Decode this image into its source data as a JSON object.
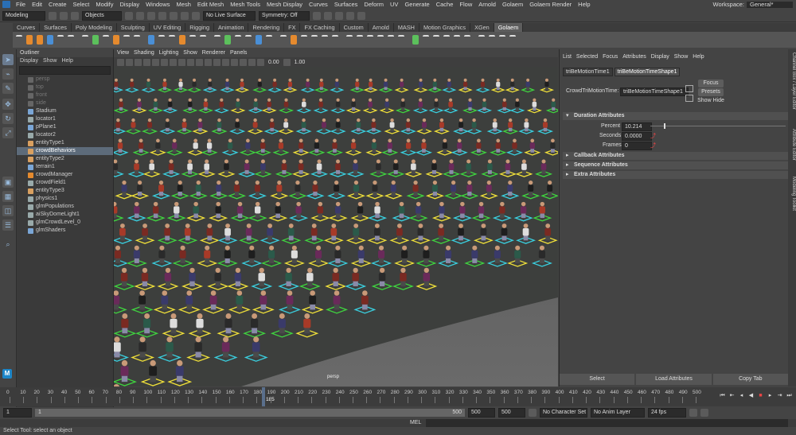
{
  "menubar": {
    "items": [
      "File",
      "Edit",
      "Create",
      "Select",
      "Modify",
      "Display",
      "Windows",
      "Mesh",
      "Edit Mesh",
      "Mesh Tools",
      "Mesh Display",
      "Curves",
      "Surfaces",
      "Deform",
      "UV",
      "Generate",
      "Cache",
      "Flow",
      "Arnold",
      "Golaem",
      "Golaem Render",
      "Help"
    ],
    "workspace_label": "Workspace:",
    "workspace_value": "General*"
  },
  "statusline": {
    "mode": "Modeling",
    "objects_label": "Objects",
    "live_surface": "No Live Surface",
    "symmetry": "Symmetry: Off"
  },
  "shelf": {
    "tabs": [
      "Curves",
      "Surfaces",
      "Poly Modeling",
      "Sculpting",
      "UV Editing",
      "Rigging",
      "Animation",
      "Rendering",
      "FX",
      "FX Caching",
      "Custom",
      "Arnold",
      "MASH",
      "Motion Graphics",
      "XGen",
      "Golaem"
    ],
    "active_tab": "Golaem"
  },
  "outliner": {
    "title": "Outliner",
    "menus": [
      "Display",
      "Show",
      "Help"
    ],
    "items": [
      {
        "label": "persp",
        "state": "dim"
      },
      {
        "label": "top",
        "state": "dim"
      },
      {
        "label": "front",
        "state": "dim"
      },
      {
        "label": "side",
        "state": "dim"
      },
      {
        "label": "Stadium",
        "state": "normal"
      },
      {
        "label": "locator1",
        "state": "normal"
      },
      {
        "label": "pPlane1",
        "state": "normal"
      },
      {
        "label": "locator2",
        "state": "normal"
      },
      {
        "label": "entityType1",
        "state": "normal"
      },
      {
        "label": "crowdBehaviors",
        "state": "selected"
      },
      {
        "label": "entityType2",
        "state": "normal"
      },
      {
        "label": "terrain1",
        "state": "normal"
      },
      {
        "label": "crowdManager",
        "state": "normal"
      },
      {
        "label": "crowdField1",
        "state": "normal"
      },
      {
        "label": "entityType3",
        "state": "normal"
      },
      {
        "label": "physics1",
        "state": "normal"
      },
      {
        "label": "glmPopulations",
        "state": "normal"
      },
      {
        "label": "aiSkyDomeLight1",
        "state": "normal"
      },
      {
        "label": "glmCrowdLevel_0",
        "state": "normal"
      },
      {
        "label": "glmShaders",
        "state": "normal"
      }
    ]
  },
  "viewport": {
    "menus": [
      "View",
      "Shading",
      "Lighting",
      "Show",
      "Renderer",
      "Panels"
    ],
    "exposure": "0.00",
    "gamma": "1.00",
    "camera_label": "persp"
  },
  "attribute_editor": {
    "menus": [
      "List",
      "Selected",
      "Focus",
      "Attributes",
      "Display",
      "Show",
      "Help"
    ],
    "tabs": [
      "triBeMotionTime1",
      "triBeMotionTimeShape1"
    ],
    "node_type_label": "CrowdTriMotionTime:",
    "node_name": "triBeMotionTimeShape1",
    "buttons": {
      "focus": "Focus",
      "presets": "Presets",
      "show_hide": "Show Hide"
    },
    "sections": {
      "duration": "Duration Attributes",
      "callback": "Callback Attributes",
      "sequence": "Sequence Attributes",
      "extra": "Extra Attributes"
    },
    "fields": {
      "percent_label": "Percent",
      "percent_value": "10.214",
      "percent_slider": 0.10214,
      "seconds_label": "Seconds",
      "seconds_value": "0.0000",
      "frames_label": "Frames",
      "frames_value": "0"
    },
    "bottom_buttons": {
      "select": "Select",
      "load": "Load Attributes",
      "copy": "Copy Tab"
    }
  },
  "side_tabs": [
    "Channel Box / Layer Editor",
    "Attribute Editor",
    "Modeling Toolkit"
  ],
  "timeslider": {
    "ticks": [
      "0",
      "10",
      "20",
      "30",
      "40",
      "50",
      "60",
      "70",
      "80",
      "90",
      "100",
      "110",
      "120",
      "130",
      "140",
      "150",
      "160",
      "170",
      "180",
      "190",
      "200",
      "210",
      "220",
      "230",
      "240",
      "250",
      "260",
      "270",
      "280",
      "290",
      "300",
      "310",
      "320",
      "330",
      "340",
      "350",
      "360",
      "370",
      "380",
      "390",
      "400",
      "410",
      "420",
      "430",
      "440",
      "450",
      "460",
      "470",
      "480",
      "490",
      "500"
    ],
    "current_frame": "185",
    "current_fraction": 0.37
  },
  "rangeslider": {
    "start": "1",
    "start_inner": "1",
    "end_inner": "500",
    "end": "500",
    "end2": "500",
    "character_set": "No Character Set",
    "anim_layer": "No Anim Layer",
    "fps": "24 fps"
  },
  "commandline": {
    "label": "MEL"
  },
  "helpline": {
    "text": "Select Tool: select an object"
  },
  "colors": {
    "selection": "#5d6b7a",
    "platform_green": "#3fd43f",
    "platform_cyan": "#3ad0e0",
    "platform_yellow": "#f0e03a",
    "stop": "#e44444"
  }
}
